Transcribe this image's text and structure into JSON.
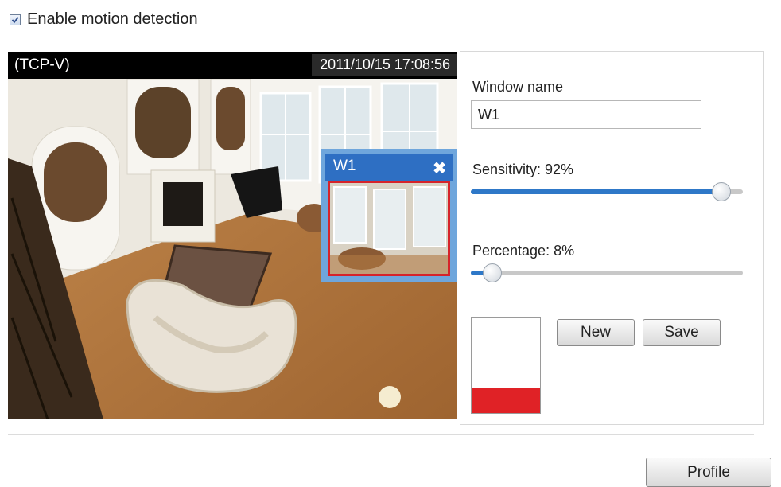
{
  "motion_detection": {
    "enable_label": "Enable motion detection",
    "enabled": true
  },
  "video": {
    "stream_label": "(TCP-V)",
    "timestamp": "2011/10/15  17:08:56"
  },
  "motion_window": {
    "name": "W1",
    "close_icon": "close-x-icon"
  },
  "settings": {
    "window_name_label": "Window name",
    "window_name_value": "W1",
    "sensitivity_label": "Sensitivity: 92%",
    "sensitivity_value": 92,
    "percentage_label": "Percentage: 8%",
    "percentage_value": 8,
    "activity_level_fraction": 0.27,
    "new_button": "New",
    "save_button": "Save"
  },
  "footer": {
    "profile_button": "Profile"
  },
  "colors": {
    "window_title_blue": "#2e6fc3",
    "slider_fill_blue": "#2e78c8",
    "alert_red": "#e02226"
  }
}
